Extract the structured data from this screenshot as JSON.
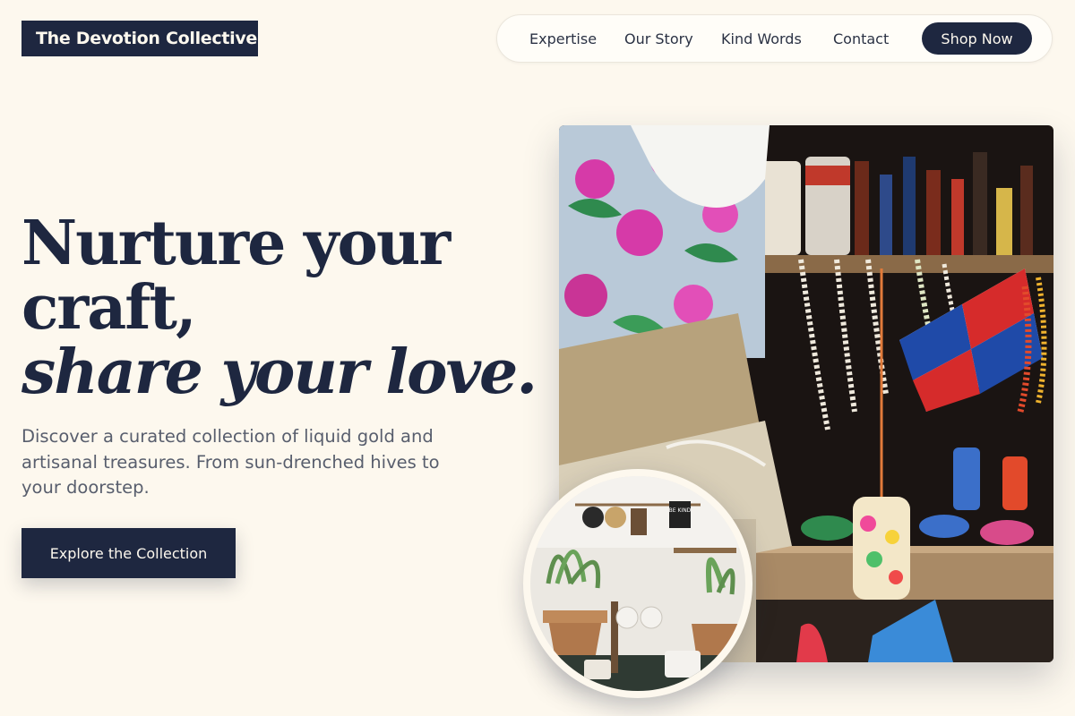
{
  "brand": {
    "name": "The Devotion Collective"
  },
  "nav": {
    "links": [
      "Expertise",
      "Our Story",
      "Kind Words",
      "Contact"
    ],
    "cta_label": "Shop Now"
  },
  "hero": {
    "headline_line1": "Nurture your",
    "headline_line2": "craft,",
    "headline_line3": "share your love.",
    "description": "Discover a curated collection of liquid gold and artisanal treasures. From sun-drenched hives to your doorstep.",
    "cta_label": "Explore the Collection"
  },
  "images": {
    "main": "market-stall-photo",
    "inset": "artisan-shop-photo",
    "sign_text": "BE KIND"
  },
  "colors": {
    "navy": "#1e2740",
    "cream": "#fdf8ee",
    "muted_text": "#585e6d"
  }
}
